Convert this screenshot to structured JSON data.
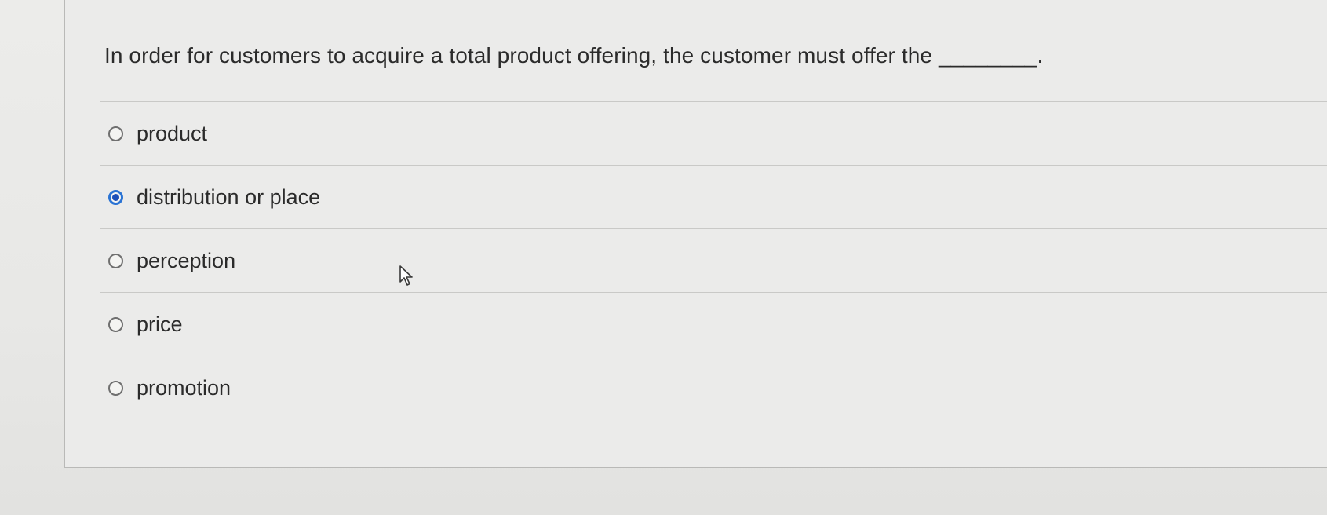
{
  "question": {
    "text": "In order for customers to acquire a total product offering, the customer must offer the",
    "blank": "________."
  },
  "options": [
    {
      "label": "product",
      "selected": false
    },
    {
      "label": "distribution or place",
      "selected": true
    },
    {
      "label": "perception",
      "selected": false
    },
    {
      "label": "price",
      "selected": false
    },
    {
      "label": "promotion",
      "selected": false
    }
  ],
  "icons": {
    "cursor": "mouse-pointer-icon"
  },
  "colors": {
    "accent": "#2a73d4",
    "text": "#2b2b2b",
    "background": "#ebebea"
  }
}
